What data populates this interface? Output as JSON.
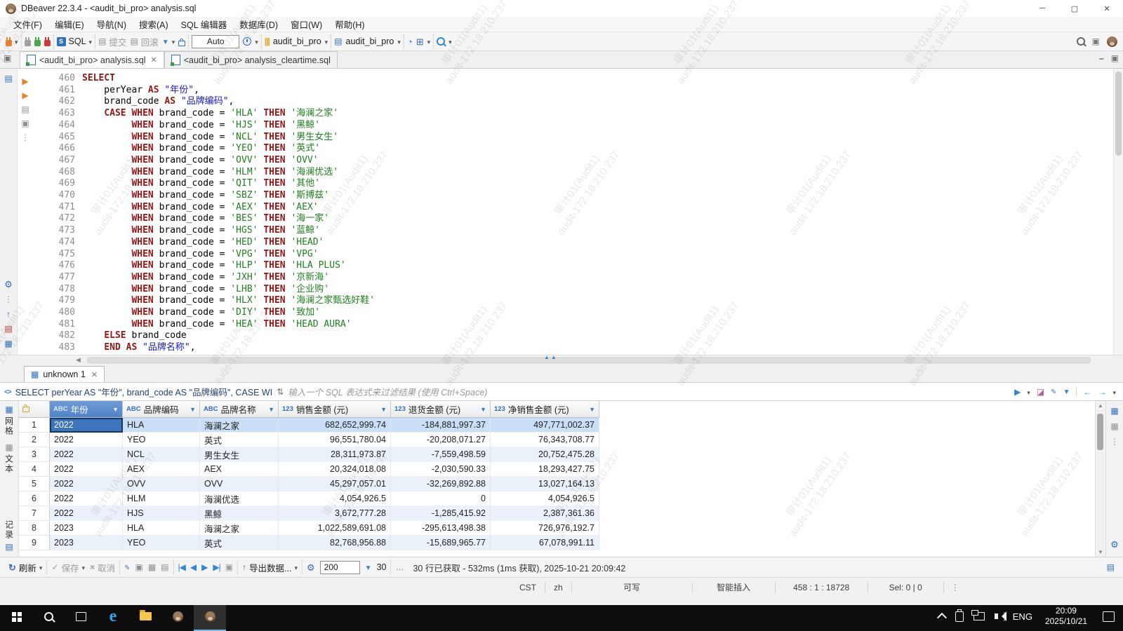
{
  "window": {
    "title": "DBeaver 22.3.4 - <audit_bi_pro> analysis.sql"
  },
  "menu": {
    "items": [
      "文件(F)",
      "编辑(E)",
      "导航(N)",
      "搜索(A)",
      "SQL 编辑器",
      "数据库(D)",
      "窗口(W)",
      "帮助(H)"
    ]
  },
  "toolbar": {
    "sql_label": "SQL",
    "commit_label": "提交",
    "rollback_label": "回滚",
    "tx_mode": "Auto",
    "connection": "audit_bi_pro",
    "schema": "audit_bi_pro"
  },
  "tabs": [
    {
      "label": "<audit_bi_pro> analysis.sql",
      "active": true
    },
    {
      "label": "<audit_bi_pro> analysis_cleartime.sql",
      "active": false
    }
  ],
  "editor": {
    "lines": [
      [
        "460",
        [
          [
            "k",
            "SELECT"
          ]
        ]
      ],
      [
        "461",
        [
          [
            "p",
            "    perYear "
          ],
          [
            "k",
            "AS"
          ],
          [
            "p",
            " "
          ],
          [
            "q",
            "\"年份\""
          ],
          [
            "p",
            ","
          ]
        ]
      ],
      [
        "462",
        [
          [
            "p",
            "    brand_code "
          ],
          [
            "k",
            "AS"
          ],
          [
            "p",
            " "
          ],
          [
            "q",
            "\"品牌编码\""
          ],
          [
            "p",
            ","
          ]
        ]
      ],
      [
        "463",
        [
          [
            "p",
            "    "
          ],
          [
            "k",
            "CASE"
          ],
          [
            "p",
            " "
          ],
          [
            "k",
            "WHEN"
          ],
          [
            "p",
            " brand_code = "
          ],
          [
            "s",
            "'HLA'"
          ],
          [
            "p",
            " "
          ],
          [
            "k",
            "THEN"
          ],
          [
            "p",
            " "
          ],
          [
            "s",
            "'海澜之家'"
          ]
        ]
      ],
      [
        "464",
        [
          [
            "p",
            "         "
          ],
          [
            "k",
            "WHEN"
          ],
          [
            "p",
            " brand_code = "
          ],
          [
            "s",
            "'HJS'"
          ],
          [
            "p",
            " "
          ],
          [
            "k",
            "THEN"
          ],
          [
            "p",
            " "
          ],
          [
            "s",
            "'黑鲸'"
          ]
        ]
      ],
      [
        "465",
        [
          [
            "p",
            "         "
          ],
          [
            "k",
            "WHEN"
          ],
          [
            "p",
            " brand_code = "
          ],
          [
            "s",
            "'NCL'"
          ],
          [
            "p",
            " "
          ],
          [
            "k",
            "THEN"
          ],
          [
            "p",
            " "
          ],
          [
            "s",
            "'男生女生'"
          ]
        ]
      ],
      [
        "466",
        [
          [
            "p",
            "         "
          ],
          [
            "k",
            "WHEN"
          ],
          [
            "p",
            " brand_code = "
          ],
          [
            "s",
            "'YEO'"
          ],
          [
            "p",
            " "
          ],
          [
            "k",
            "THEN"
          ],
          [
            "p",
            " "
          ],
          [
            "s",
            "'英式'"
          ]
        ]
      ],
      [
        "467",
        [
          [
            "p",
            "         "
          ],
          [
            "k",
            "WHEN"
          ],
          [
            "p",
            " brand_code = "
          ],
          [
            "s",
            "'OVV'"
          ],
          [
            "p",
            " "
          ],
          [
            "k",
            "THEN"
          ],
          [
            "p",
            " "
          ],
          [
            "s",
            "'OVV'"
          ]
        ]
      ],
      [
        "468",
        [
          [
            "p",
            "         "
          ],
          [
            "k",
            "WHEN"
          ],
          [
            "p",
            " brand_code = "
          ],
          [
            "s",
            "'HLM'"
          ],
          [
            "p",
            " "
          ],
          [
            "k",
            "THEN"
          ],
          [
            "p",
            " "
          ],
          [
            "s",
            "'海澜优选'"
          ]
        ]
      ],
      [
        "469",
        [
          [
            "p",
            "         "
          ],
          [
            "k",
            "WHEN"
          ],
          [
            "p",
            " brand_code = "
          ],
          [
            "s",
            "'QIT'"
          ],
          [
            "p",
            " "
          ],
          [
            "k",
            "THEN"
          ],
          [
            "p",
            " "
          ],
          [
            "s",
            "'其他'"
          ]
        ]
      ],
      [
        "470",
        [
          [
            "p",
            "         "
          ],
          [
            "k",
            "WHEN"
          ],
          [
            "p",
            " brand_code = "
          ],
          [
            "s",
            "'SBZ'"
          ],
          [
            "p",
            " "
          ],
          [
            "k",
            "THEN"
          ],
          [
            "p",
            " "
          ],
          [
            "s",
            "'斯搏兹'"
          ]
        ]
      ],
      [
        "471",
        [
          [
            "p",
            "         "
          ],
          [
            "k",
            "WHEN"
          ],
          [
            "p",
            " brand_code = "
          ],
          [
            "s",
            "'AEX'"
          ],
          [
            "p",
            " "
          ],
          [
            "k",
            "THEN"
          ],
          [
            "p",
            " "
          ],
          [
            "s",
            "'AEX'"
          ]
        ]
      ],
      [
        "472",
        [
          [
            "p",
            "         "
          ],
          [
            "k",
            "WHEN"
          ],
          [
            "p",
            " brand_code = "
          ],
          [
            "s",
            "'BES'"
          ],
          [
            "p",
            " "
          ],
          [
            "k",
            "THEN"
          ],
          [
            "p",
            " "
          ],
          [
            "s",
            "'海一家'"
          ]
        ]
      ],
      [
        "473",
        [
          [
            "p",
            "         "
          ],
          [
            "k",
            "WHEN"
          ],
          [
            "p",
            " brand_code = "
          ],
          [
            "s",
            "'HGS'"
          ],
          [
            "p",
            " "
          ],
          [
            "k",
            "THEN"
          ],
          [
            "p",
            " "
          ],
          [
            "s",
            "'蓝鲸'"
          ]
        ]
      ],
      [
        "474",
        [
          [
            "p",
            "         "
          ],
          [
            "k",
            "WHEN"
          ],
          [
            "p",
            " brand_code = "
          ],
          [
            "s",
            "'HED'"
          ],
          [
            "p",
            " "
          ],
          [
            "k",
            "THEN"
          ],
          [
            "p",
            " "
          ],
          [
            "s",
            "'HEAD'"
          ]
        ]
      ],
      [
        "475",
        [
          [
            "p",
            "         "
          ],
          [
            "k",
            "WHEN"
          ],
          [
            "p",
            " brand_code = "
          ],
          [
            "s",
            "'VPG'"
          ],
          [
            "p",
            " "
          ],
          [
            "k",
            "THEN"
          ],
          [
            "p",
            " "
          ],
          [
            "s",
            "'VPG'"
          ]
        ]
      ],
      [
        "476",
        [
          [
            "p",
            "         "
          ],
          [
            "k",
            "WHEN"
          ],
          [
            "p",
            " brand_code = "
          ],
          [
            "s",
            "'HLP'"
          ],
          [
            "p",
            " "
          ],
          [
            "k",
            "THEN"
          ],
          [
            "p",
            " "
          ],
          [
            "s",
            "'HLA PLUS'"
          ]
        ]
      ],
      [
        "477",
        [
          [
            "p",
            "         "
          ],
          [
            "k",
            "WHEN"
          ],
          [
            "p",
            " brand_code = "
          ],
          [
            "s",
            "'JXH'"
          ],
          [
            "p",
            " "
          ],
          [
            "k",
            "THEN"
          ],
          [
            "p",
            " "
          ],
          [
            "s",
            "'京新海'"
          ]
        ]
      ],
      [
        "478",
        [
          [
            "p",
            "         "
          ],
          [
            "k",
            "WHEN"
          ],
          [
            "p",
            " brand_code = "
          ],
          [
            "s",
            "'LHB'"
          ],
          [
            "p",
            " "
          ],
          [
            "k",
            "THEN"
          ],
          [
            "p",
            " "
          ],
          [
            "s",
            "'企业购'"
          ]
        ]
      ],
      [
        "479",
        [
          [
            "p",
            "         "
          ],
          [
            "k",
            "WHEN"
          ],
          [
            "p",
            " brand_code = "
          ],
          [
            "s",
            "'HLX'"
          ],
          [
            "p",
            " "
          ],
          [
            "k",
            "THEN"
          ],
          [
            "p",
            " "
          ],
          [
            "s",
            "'海澜之家甄选好鞋'"
          ]
        ]
      ],
      [
        "480",
        [
          [
            "p",
            "         "
          ],
          [
            "k",
            "WHEN"
          ],
          [
            "p",
            " brand_code = "
          ],
          [
            "s",
            "'DIY'"
          ],
          [
            "p",
            " "
          ],
          [
            "k",
            "THEN"
          ],
          [
            "p",
            " "
          ],
          [
            "s",
            "'致加'"
          ]
        ]
      ],
      [
        "481",
        [
          [
            "p",
            "         "
          ],
          [
            "k",
            "WHEN"
          ],
          [
            "p",
            " brand_code = "
          ],
          [
            "s",
            "'HEA'"
          ],
          [
            "p",
            " "
          ],
          [
            "k",
            "THEN"
          ],
          [
            "p",
            " "
          ],
          [
            "s",
            "'HEAD AURA'"
          ]
        ]
      ],
      [
        "482",
        [
          [
            "p",
            "    "
          ],
          [
            "k",
            "ELSE"
          ],
          [
            "p",
            " brand_code"
          ]
        ]
      ],
      [
        "483",
        [
          [
            "p",
            "    "
          ],
          [
            "k",
            "END"
          ],
          [
            "p",
            " "
          ],
          [
            "k",
            "AS"
          ],
          [
            "p",
            " "
          ],
          [
            "q",
            "\"品牌名称\""
          ],
          [
            "p",
            ","
          ]
        ]
      ]
    ]
  },
  "results": {
    "tab": "unknown 1",
    "filter": {
      "query": "SELECT perYear AS \"年份\", brand_code AS \"品牌编码\", CASE WI",
      "placeholder": "输入一个 SQL 表达式来过滤结果 (使用 Ctrl+Space)"
    },
    "side_tabs": [
      "网格",
      "文本"
    ],
    "side_bottom": "记录",
    "grid": {
      "columns": [
        {
          "type": "ABC",
          "label": "年份"
        },
        {
          "type": "ABC",
          "label": "品牌编码"
        },
        {
          "type": "ABC",
          "label": "品牌名称"
        },
        {
          "type": "123",
          "label": "销售金额 (元)"
        },
        {
          "type": "123",
          "label": "退货金额 (元)"
        },
        {
          "type": "123",
          "label": "净销售金额 (元)"
        }
      ],
      "rows": [
        [
          "2022",
          "HLA",
          "海澜之家",
          "682,652,999.74",
          "-184,881,997.37",
          "497,771,002.37"
        ],
        [
          "2022",
          "YEO",
          "英式",
          "96,551,780.04",
          "-20,208,071.27",
          "76,343,708.77"
        ],
        [
          "2022",
          "NCL",
          "男生女生",
          "28,311,973.87",
          "-7,559,498.59",
          "20,752,475.28"
        ],
        [
          "2022",
          "AEX",
          "AEX",
          "20,324,018.08",
          "-2,030,590.33",
          "18,293,427.75"
        ],
        [
          "2022",
          "OVV",
          "OVV",
          "45,297,057.01",
          "-32,269,892.88",
          "13,027,164.13"
        ],
        [
          "2022",
          "HLM",
          "海澜优选",
          "4,054,926.5",
          "0",
          "4,054,926.5"
        ],
        [
          "2022",
          "HJS",
          "黑鲸",
          "3,672,777.28",
          "-1,285,415.92",
          "2,387,361.36"
        ],
        [
          "2023",
          "HLA",
          "海澜之家",
          "1,022,589,691.08",
          "-295,613,498.38",
          "726,976,192.7"
        ],
        [
          "2023",
          "YEO",
          "英式",
          "82,768,956.88",
          "-15,689,965.77",
          "67,078,991.11"
        ]
      ]
    },
    "toolbar": {
      "refresh": "刷新",
      "save": "保存",
      "cancel": "取消",
      "export": "导出数据...",
      "page_size": "200",
      "fetch_size": "30",
      "status": "30 行已获取 - 532ms (1ms 获取), 2025-10-21 20:09:42"
    }
  },
  "statusbar": {
    "cells": [
      "CST",
      "zh",
      "可写",
      "智能插入",
      "458 : 1 : 18728",
      "Sel: 0 | 0"
    ]
  },
  "taskbar": {
    "lang": "ENG",
    "time": "20:09",
    "date": "2025/10/21"
  },
  "watermark": {
    "line1": "审计01(Audit1)",
    "line2": "audit-172.18.210.237"
  },
  "colors": {
    "accent": "#2f6fc0",
    "keyword": "#951616",
    "string": "#1e801e",
    "identifier": "#1919c4",
    "selection": "#c9dff5"
  }
}
